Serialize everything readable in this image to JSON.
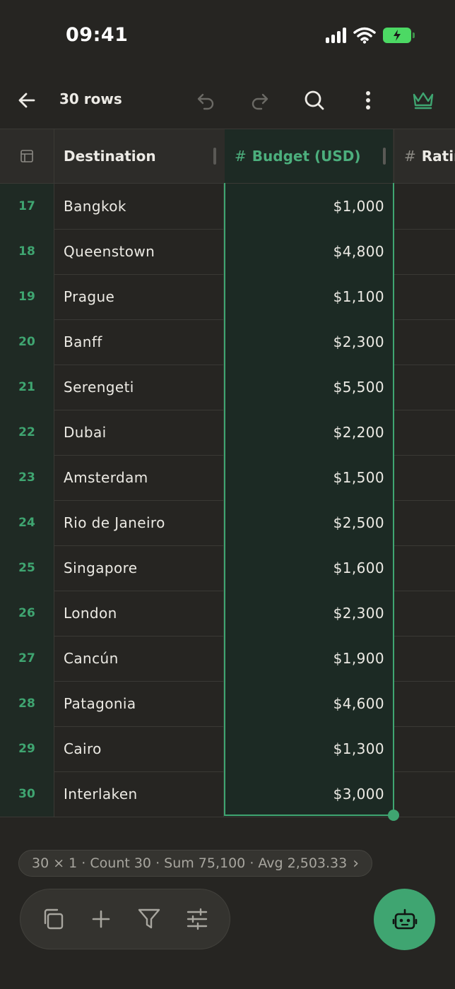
{
  "status_bar": {
    "time": "09:41"
  },
  "toolbar": {
    "title": "30 rows"
  },
  "columns": {
    "destination": "Destination",
    "budget_hash": "#",
    "budget": "Budget (USD)",
    "rating_hash": "#",
    "rating": "Ratin"
  },
  "rows": [
    {
      "num": "17",
      "destination": "Bangkok",
      "budget": "$1,000"
    },
    {
      "num": "18",
      "destination": "Queenstown",
      "budget": "$4,800"
    },
    {
      "num": "19",
      "destination": "Prague",
      "budget": "$1,100"
    },
    {
      "num": "20",
      "destination": "Banff",
      "budget": "$2,300"
    },
    {
      "num": "21",
      "destination": "Serengeti",
      "budget": "$5,500"
    },
    {
      "num": "22",
      "destination": "Dubai",
      "budget": "$2,200"
    },
    {
      "num": "23",
      "destination": "Amsterdam",
      "budget": "$1,500"
    },
    {
      "num": "24",
      "destination": "Rio de Janeiro",
      "budget": "$2,500"
    },
    {
      "num": "25",
      "destination": "Singapore",
      "budget": "$1,600"
    },
    {
      "num": "26",
      "destination": "London",
      "budget": "$2,300"
    },
    {
      "num": "27",
      "destination": "Cancún",
      "budget": "$1,900"
    },
    {
      "num": "28",
      "destination": "Patagonia",
      "budget": "$4,600"
    },
    {
      "num": "29",
      "destination": "Cairo",
      "budget": "$1,300"
    },
    {
      "num": "30",
      "destination": "Interlaken",
      "budget": "$3,000"
    }
  ],
  "summary": {
    "text": "30 × 1 · Count 30 · Sum 75,100 · Avg 2,503.33",
    "chevron": "›"
  },
  "icons": {
    "back": "back-arrow-icon",
    "undo": "undo-icon",
    "redo": "redo-icon",
    "search": "search-icon",
    "more": "more-vertical-icon",
    "premium": "crown-icon",
    "copy": "copy-icon",
    "add": "plus-icon",
    "filter": "filter-icon",
    "adjust": "sliders-icon",
    "assistant": "robot-icon",
    "table": "table-icon"
  },
  "colors": {
    "accent": "#3FA571",
    "background": "#262522",
    "selected_column": "#1C2A24"
  }
}
